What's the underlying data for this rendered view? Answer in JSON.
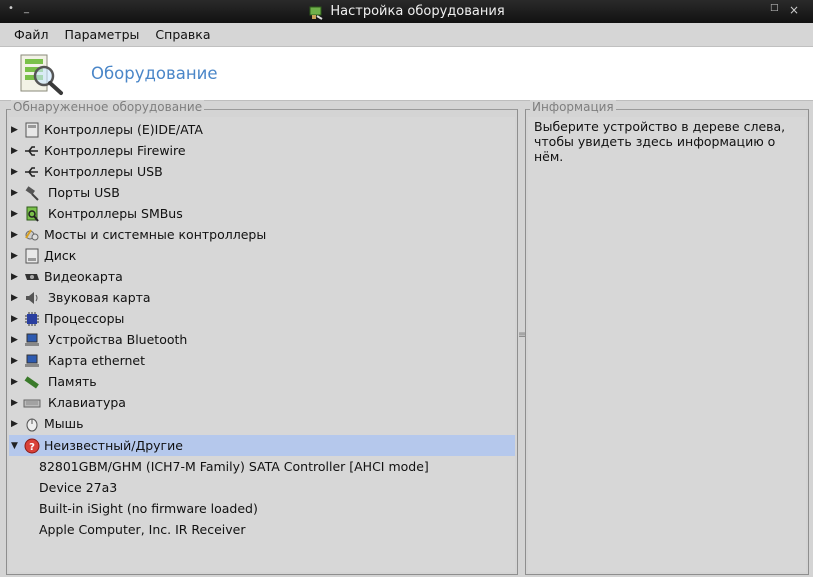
{
  "window": {
    "title": "Настройка оборудования",
    "buttons": {
      "menu": "•",
      "minimize": "_",
      "maximize": "□",
      "close": "×"
    }
  },
  "menu": [
    "Файл",
    "Параметры",
    "Справка"
  ],
  "header": {
    "title": "Оборудование",
    "icon": "hardware-search-icon"
  },
  "left_panel": {
    "legend": "Обнаруженное оборудование",
    "items": [
      {
        "label": "Контроллеры (E)IDE/ATA",
        "icon": "ide-controller-icon",
        "expanded": false
      },
      {
        "label": "Контроллеры Firewire",
        "icon": "firewire-icon",
        "expanded": false
      },
      {
        "label": "Контроллеры USB",
        "icon": "usb-icon",
        "expanded": false
      },
      {
        "label": "Порты USB",
        "icon": "usb-port-icon",
        "expanded": false
      },
      {
        "label": "Контроллеры SMBus",
        "icon": "smbus-icon",
        "expanded": false
      },
      {
        "label": "Мосты и системные контроллеры",
        "icon": "bridge-icon",
        "expanded": false
      },
      {
        "label": "Диск",
        "icon": "disk-icon",
        "expanded": false
      },
      {
        "label": "Видеокарта",
        "icon": "video-card-icon",
        "expanded": false
      },
      {
        "label": "Звуковая карта",
        "icon": "speaker-icon",
        "expanded": false
      },
      {
        "label": "Процессоры",
        "icon": "cpu-icon",
        "expanded": false
      },
      {
        "label": "Устройства Bluetooth",
        "icon": "bluetooth-computer-icon",
        "expanded": false
      },
      {
        "label": "Карта ethernet",
        "icon": "network-computer-icon",
        "expanded": false
      },
      {
        "label": "Память",
        "icon": "memory-icon",
        "expanded": false
      },
      {
        "label": "Клавиатура",
        "icon": "keyboard-icon",
        "expanded": false
      },
      {
        "label": "Мышь",
        "icon": "mouse-icon",
        "expanded": false
      },
      {
        "label": "Неизвестный/Другие",
        "icon": "unknown-device-icon",
        "expanded": true,
        "selected": true
      }
    ],
    "children": [
      "82801GBM/GHM (ICH7-M Family) SATA Controller [AHCI mode]",
      "Device 27a3",
      "Built-in iSight (no firmware loaded)",
      "Apple Computer, Inc. IR Receiver"
    ]
  },
  "right_panel": {
    "legend": "Информация",
    "text_line1": "Выберите устройство в дереве слева,",
    "text_line2": "чтобы увидеть здесь информацию о нём."
  },
  "colors": {
    "selection": "#b5c8ec",
    "header_title": "#4a86c8",
    "titlebar": "#1a1a1a"
  }
}
